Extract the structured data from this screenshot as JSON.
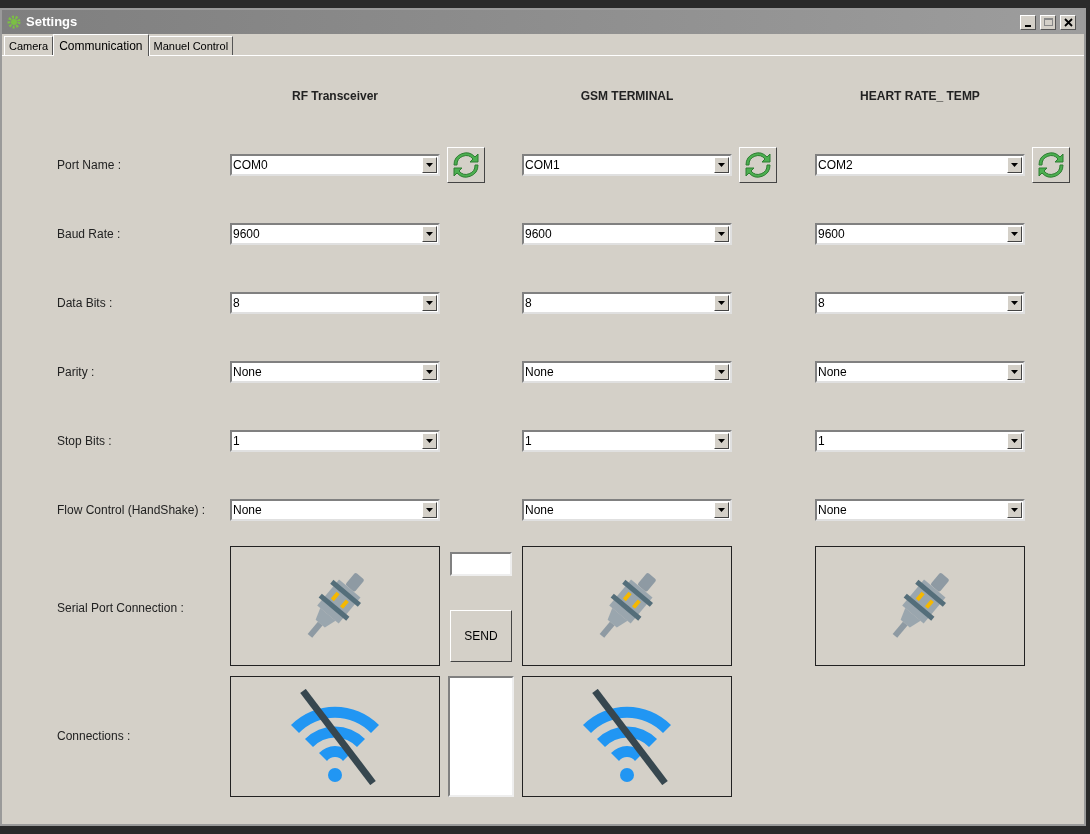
{
  "window": {
    "title": "Settings"
  },
  "tabs": [
    {
      "label": "Camera",
      "selected": false
    },
    {
      "label": "Communication",
      "selected": true
    },
    {
      "label": "Manuel Control",
      "selected": false
    }
  ],
  "row_labels": [
    "Port Name :",
    "Baud Rate :",
    "Data Bits :",
    "Parity :",
    "Stop Bits :",
    "Flow Control (HandShake) :",
    "Serial Port Connection :",
    "Connections :"
  ],
  "devices": [
    {
      "heading": "RF Transceiver",
      "values": [
        "COM0",
        "9600",
        "8",
        "None",
        "1",
        "None"
      ],
      "connection_indicator": true
    },
    {
      "heading": "GSM TERMINAL",
      "values": [
        "COM1",
        "9600",
        "8",
        "None",
        "1",
        "None"
      ],
      "connection_indicator": true
    },
    {
      "heading": "HEART RATE_ TEMP",
      "values": [
        "COM2",
        "9600",
        "8",
        "None",
        "1",
        "None"
      ],
      "connection_indicator": false
    }
  ],
  "send_button": "SEND"
}
